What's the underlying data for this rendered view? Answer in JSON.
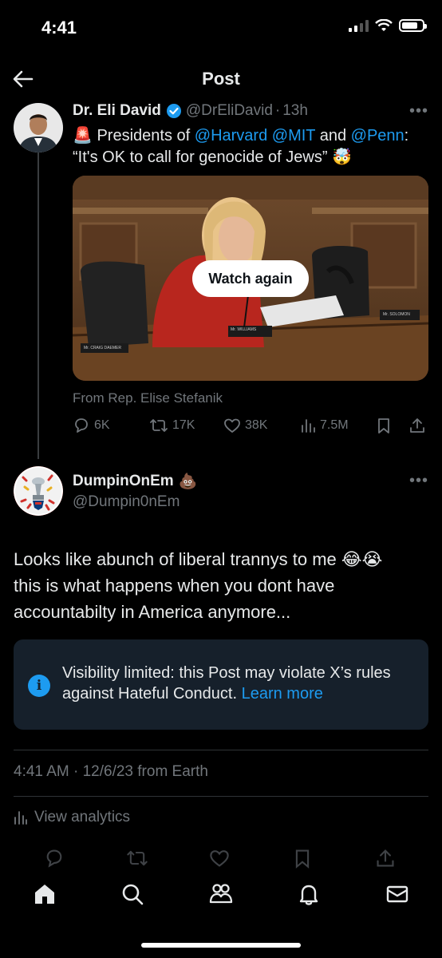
{
  "status_bar": {
    "time": "4:41"
  },
  "header": {
    "title": "Post"
  },
  "quoted_post": {
    "display_name": "Dr. Eli David",
    "handle": "@DrEliDavid",
    "time_sep": "·",
    "time": "13h",
    "emoji_alarm": "🚨",
    "text_pre": "Presidents of",
    "mention_1": "@Harvard",
    "mention_2": "@MIT",
    "text_and": "and",
    "mention_3": "@Penn",
    "text_colon": ":",
    "text_line2": "“It's OK to call for genocide of Jews”",
    "emoji_end": "🤯",
    "media_button": "Watch again",
    "media_labels": {
      "left": "Mr. CRAIG DAEMER",
      "center": "Mr. WILLIAMS",
      "right": "Mr. SOLOMON"
    },
    "from": "From Rep. Elise Stefanik",
    "stats": {
      "replies": "6K",
      "reposts": "17K",
      "likes": "38K",
      "views": "7.5M"
    }
  },
  "reply": {
    "display_name": "DumpinOnEm",
    "name_emoji": "💩",
    "handle": "@Dumpin0nEm",
    "text_line1": "Looks like abunch of liberal trannys to me",
    "text_emojis": "😂😭",
    "text_line2": "this is what happens when you dont have",
    "text_line3": "accountabilty in America anymore..."
  },
  "visibility_notice": {
    "icon": "i",
    "line1": "Visibility limited: this Post may violate X’s rules",
    "line2": "against Hateful Conduct.",
    "link": "Learn more"
  },
  "meta": {
    "timestamp": "4:41 AM · 12/6/23 from Earth",
    "analytics": "View analytics"
  },
  "icons": [
    "back-arrow-icon",
    "verified-icon",
    "more-icon",
    "reply-icon",
    "repost-icon",
    "like-icon",
    "views-icon",
    "bookmark-icon",
    "share-icon",
    "info-icon",
    "analytics-icon",
    "home-icon",
    "search-icon",
    "communities-icon",
    "notifications-icon",
    "messages-icon"
  ],
  "colors": {
    "accent": "#1d9bf0",
    "background": "#000000",
    "muted": "#71767b",
    "notice_bg": "#16202b"
  }
}
